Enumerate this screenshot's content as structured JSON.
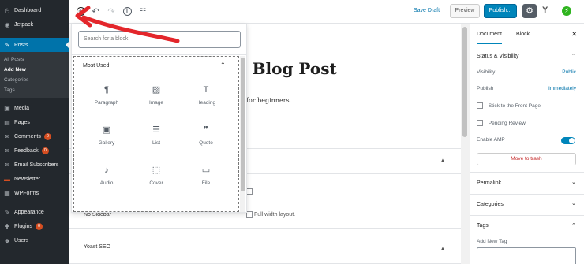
{
  "sidebar": {
    "items": [
      {
        "icon": "dashboard-icon",
        "glyph": "◷",
        "label": "Dashboard",
        "badge": ""
      },
      {
        "icon": "jetpack-icon",
        "glyph": "◉",
        "label": "Jetpack",
        "badge": ""
      },
      {
        "icon": "pin-icon",
        "glyph": "✎",
        "label": "Posts",
        "badge": ""
      }
    ],
    "sub_items": [
      "All Posts",
      "Add New",
      "Categories",
      "Tags"
    ],
    "lower_items": [
      {
        "icon": "media-icon",
        "glyph": "▣",
        "label": "Media",
        "badge": ""
      },
      {
        "icon": "pages-icon",
        "glyph": "▤",
        "label": "Pages",
        "badge": ""
      },
      {
        "icon": "comments-icon",
        "glyph": "✉",
        "label": "Comments",
        "badge": "0"
      },
      {
        "icon": "feedback-icon",
        "glyph": "✉",
        "label": "Feedback",
        "badge": "0"
      },
      {
        "icon": "email-icon",
        "glyph": "✉",
        "label": "Email Subscribers",
        "badge": ""
      },
      {
        "icon": "newsletter-icon",
        "glyph": "▬",
        "label": "Newsletter",
        "badge": ""
      },
      {
        "icon": "forms-icon",
        "glyph": "▦",
        "label": "WPForms",
        "badge": ""
      },
      {
        "icon": "appearance-icon",
        "glyph": "✎",
        "label": "Appearance",
        "badge": ""
      },
      {
        "icon": "plugins-icon",
        "glyph": "✚",
        "label": "Plugins",
        "badge": "0"
      },
      {
        "icon": "users-icon",
        "glyph": "☻",
        "label": "Users",
        "badge": ""
      }
    ]
  },
  "toolbar": {
    "save_draft": "Save Draft",
    "preview": "Preview",
    "publish": "Publish..."
  },
  "editor": {
    "title_fragment": "e a Blog Post",
    "para_fragment": "for beginners.",
    "no_sidebar": "No Sidebar",
    "full_width": "Full width layout.",
    "yoast": "Yoast SEO"
  },
  "inserter": {
    "search_placeholder": "Search for a block",
    "section_title": "Most Used",
    "blocks": [
      {
        "label": "Paragraph",
        "glyph": "¶",
        "icon": "paragraph-icon"
      },
      {
        "label": "Image",
        "glyph": "▨",
        "icon": "image-icon"
      },
      {
        "label": "Heading",
        "glyph": "T",
        "icon": "heading-icon"
      },
      {
        "label": "Gallery",
        "glyph": "▣",
        "icon": "gallery-icon"
      },
      {
        "label": "List",
        "glyph": "☰",
        "icon": "list-icon"
      },
      {
        "label": "Quote",
        "glyph": "❞",
        "icon": "quote-icon"
      },
      {
        "label": "Audio",
        "glyph": "♪",
        "icon": "audio-icon"
      },
      {
        "label": "Cover",
        "glyph": "⬚",
        "icon": "cover-icon"
      },
      {
        "label": "File",
        "glyph": "▭",
        "icon": "file-icon"
      }
    ]
  },
  "panel": {
    "tab_document": "Document",
    "tab_block": "Block",
    "status_title": "Status & Visibility",
    "visibility_label": "Visibility",
    "visibility_value": "Public",
    "publish_label": "Publish",
    "publish_value": "Immediately",
    "sticky": "Stick to the Front Page",
    "pending": "Pending Review",
    "amp": "Enable AMP",
    "amp_enabled": true,
    "trash": "Move to trash",
    "permalink": "Permalink",
    "categories": "Categories",
    "tags": "Tags",
    "add_tag": "Add New Tag"
  },
  "colors": {
    "admin_bg": "#23282d",
    "accent": "#0073aa",
    "annotation": "#e3262b"
  }
}
